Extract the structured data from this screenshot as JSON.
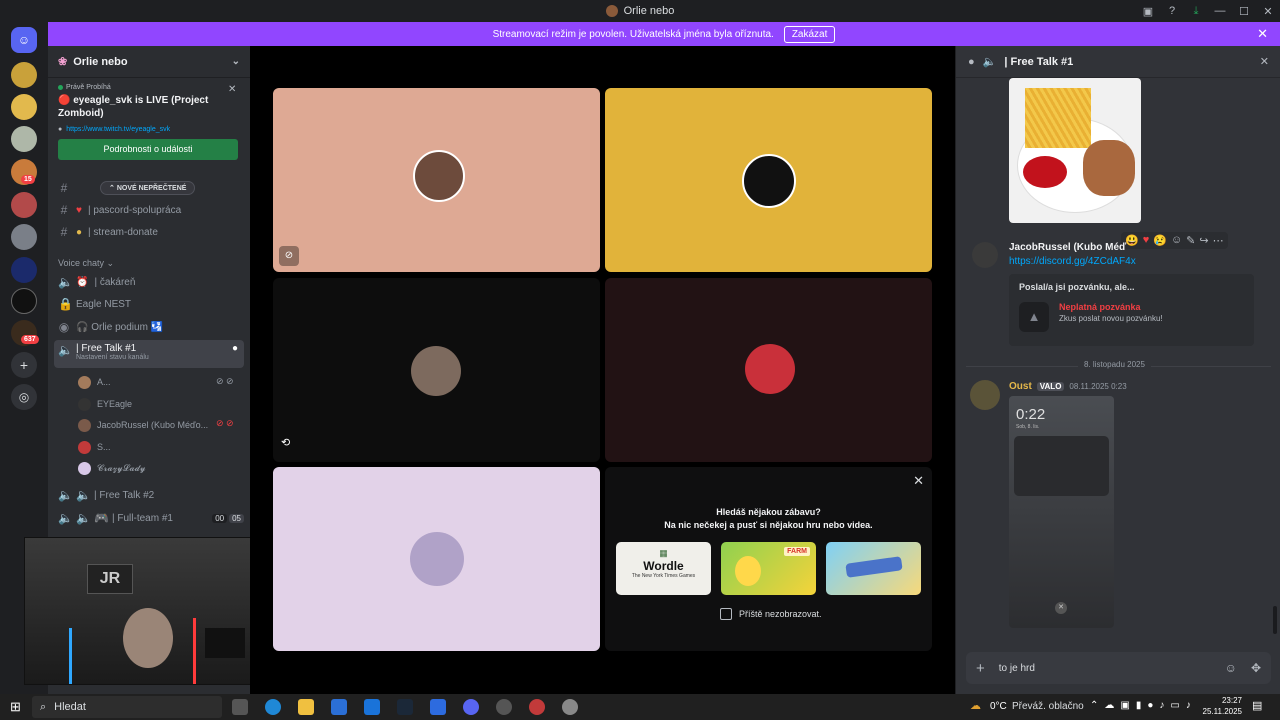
{
  "window": {
    "title": "Orlie nebo"
  },
  "banner": {
    "text": "Streamovací režim je povolen. Uživatelská jména byla oříznuta.",
    "button": "Zakázat"
  },
  "server": {
    "name": "Orlie nebo"
  },
  "event": {
    "status": "Právě Probíhá",
    "title": "🔴 eyeagle_svk is LIVE (Project Zomboid)",
    "link": "https://www.twitch.tv/eyeagle_svk",
    "button": "Podrobnosti o události"
  },
  "new_unread": "NOVÉ NEPŘEČTENÉ",
  "text_channels": [
    {
      "name": "| pascord-spolupráca"
    },
    {
      "name": "| stream-donate"
    }
  ],
  "voice_section": "Voice chaty",
  "voice_channels": [
    {
      "name": "| čakáreň"
    },
    {
      "name": "Eagle NEST"
    },
    {
      "name": "🎧 Orlie podium 🛂"
    },
    {
      "name": "| Free Talk #1",
      "status": "Nastavení stavu kanálu"
    },
    {
      "name": "| Free Talk #2"
    },
    {
      "name": "| Full-team #1",
      "count_a": "00",
      "count_b": "05"
    }
  ],
  "voice_users": [
    {
      "name": "A..."
    },
    {
      "name": "EYEagle"
    },
    {
      "name": "JacobRussel (Kubo Méďo..."
    },
    {
      "name": "S..."
    },
    {
      "name": "𝓒𝓻𝓪𝔃𝔂𝓛𝓪𝓭𝔂"
    }
  ],
  "activity": {
    "heading": "Hledáš nějakou zábavu?",
    "sub": "Na nic nečekej a pusť si nějakou hru nebo videa.",
    "games": [
      "Wordle",
      "Chicken Farm",
      "Putt Party"
    ],
    "wordle_sub": "The New York Times Games",
    "checkbox_label": "Příště nezobrazovat."
  },
  "chat": {
    "channel": "| Free Talk #1",
    "message1": {
      "author": "JacobRussel (Kubo Méď",
      "link": "https://discord.gg/4ZCdAF4x"
    },
    "invite": {
      "heading": "Poslal/a jsi pozvánku, ale...",
      "invalid": "Neplatná pozvánka",
      "hint": "Zkus poslat novou pozvánku!"
    },
    "date_divider": "8. listopadu 2025",
    "message2": {
      "author": "Oust",
      "tag": "VALO",
      "time": "08.11.2025 0:23"
    },
    "phone": {
      "time": "0:22",
      "date": "Sob, 8. lis."
    },
    "input_value": "to je hrd"
  },
  "taskbar": {
    "search": "Hledat",
    "weather_temp": "0°C",
    "weather_text": "Převáž. oblačno",
    "time": "23:27",
    "date": "25.11.2025"
  },
  "colors": {
    "accent": "#9146ff",
    "green": "#248046",
    "bg": "#313338"
  }
}
